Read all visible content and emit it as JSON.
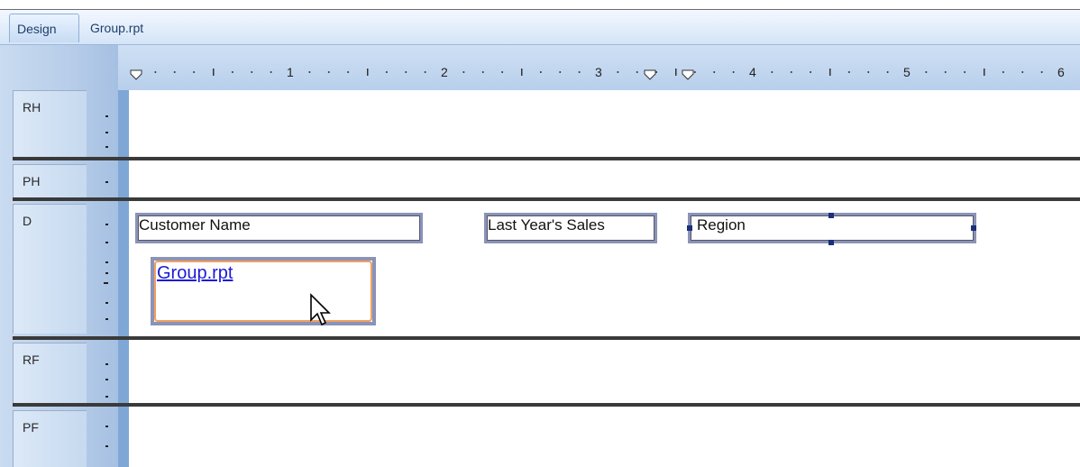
{
  "tabs": [
    {
      "label": "Design"
    },
    {
      "label": "Group.rpt"
    }
  ],
  "ruler": {
    "numbers": [
      "1",
      "2",
      "3",
      "4",
      "5",
      "6"
    ]
  },
  "sections": [
    {
      "label": "RH"
    },
    {
      "label": "PH"
    },
    {
      "label": "D"
    },
    {
      "label": "RF"
    },
    {
      "label": "PF"
    }
  ],
  "fields": {
    "customer_name": "Customer Name",
    "last_years_sales": "Last Year's Sales",
    "region": "Region",
    "subreport_link": "Group.rpt"
  },
  "colors": {
    "field_border": "#8a93b8",
    "link": "#1a1ad6",
    "subreport_highlight": "#f0a060",
    "panel_blue": "#b7cde9"
  }
}
